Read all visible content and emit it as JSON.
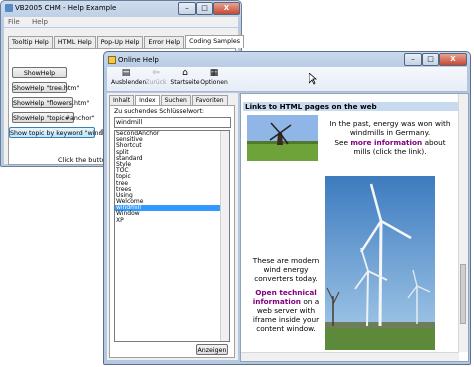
{
  "back_window": {
    "title": "VB2005 CHM - Help Example",
    "menu": [
      "File",
      "Help"
    ],
    "caption_buttons": [
      "–",
      "□",
      "X"
    ],
    "tabs": [
      "Tooltip Help",
      "HTML Help",
      "Pop-Up Help",
      "Error Help",
      "Coding Samples"
    ],
    "active_tab": "Coding Samples",
    "buttons": [
      "ShowHelp",
      "ShowHelp \"tree.htm\"",
      "ShowHelp \"flowers.htm\"",
      "ShowHelp \"topic#anchor\"",
      "Show topic by keyword \"windmill\""
    ],
    "footer_text": "Click the buttons to s"
  },
  "help_window": {
    "title": "Online Help",
    "caption_buttons": [
      "–",
      "□",
      "X"
    ],
    "toolbar": [
      {
        "label": "Ausblenden",
        "icon": "hide-icon",
        "enabled": true
      },
      {
        "label": "Zurück",
        "icon": "back-arrow-icon",
        "enabled": false
      },
      {
        "label": "Startseite",
        "icon": "home-icon",
        "enabled": true
      },
      {
        "label": "Optionen",
        "icon": "options-icon",
        "enabled": true
      }
    ],
    "nav_tabs": [
      "Inhalt",
      "Index",
      "Suchen",
      "Favoriten"
    ],
    "active_nav_tab": "Index",
    "keyword_label": "Zu suchendes Schlüsselwort:",
    "keyword_value": "windmill",
    "keywords": [
      "SecondAnchor",
      "sensitive",
      "Shortcut",
      "split",
      "standard",
      "Style",
      "TOC",
      "topic",
      "tree",
      "trees",
      "Using",
      "Welcome",
      "windmill",
      "Window",
      "XP"
    ],
    "selected_keyword": "windmill",
    "show_button": "Anzeigen",
    "content": {
      "heading": "Links to HTML pages on the web",
      "para1": "In the past, energy was won with windmills in Germany.",
      "para2_prefix": "See",
      "para2_link": "more information",
      "para2_suffix": "about mills (click the link).",
      "para3": "These are modern wind energy converters today.",
      "para4_link": "Open technical information",
      "para4_suffix": "on a web server with iframe inside your content window."
    }
  },
  "colors": {
    "accent": "#3399ff",
    "link": "#800080",
    "heading_bg": "#c8daf0"
  }
}
